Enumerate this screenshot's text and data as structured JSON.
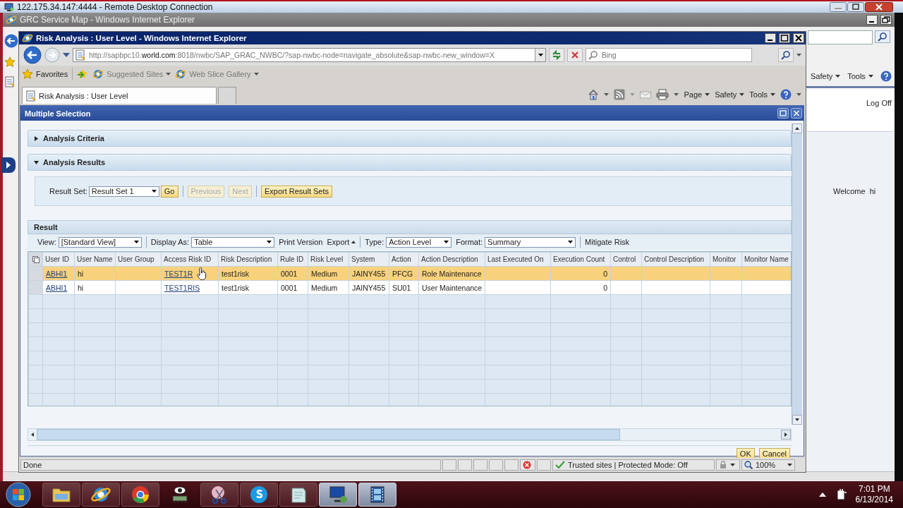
{
  "remote_desktop": {
    "title": "122.175.34.147:4444 - Remote Desktop Connection"
  },
  "background_window": {
    "title": "GRC Service Map - Windows Internet Explorer",
    "commands": [
      "Safety",
      "Tools"
    ],
    "log_off": "Log Off",
    "welcome": "Welcome",
    "user": "hi"
  },
  "window": {
    "title": "Risk Analysis : User Level - Windows Internet Explorer",
    "address": "http://sapbpc10.**world.com**:8018/nwbc/SAP_GRAC_NWBC/?sap-nwbc-node=navigate_absolute&sap-nwbc-new_window=X",
    "search_placeholder": "Bing",
    "favorites": "Favorites",
    "favorite_links": [
      "Suggested Sites",
      "Web Slice Gallery"
    ],
    "tabs": [
      {
        "label": "Risk Analysis : User Level",
        "selected": true
      }
    ],
    "commands": [
      "Page",
      "Safety",
      "Tools"
    ]
  },
  "dialog": {
    "title": "Multiple Selection",
    "sections": [
      {
        "label": "Analysis Criteria",
        "expanded": false
      },
      {
        "label": "Analysis Results",
        "expanded": true
      }
    ],
    "result_set": {
      "label": "Result Set:",
      "value": "Result Set 1"
    },
    "actions": [
      {
        "label": "Go",
        "disabled": false
      },
      {
        "label": "Previous",
        "disabled": true
      },
      {
        "label": "Next",
        "disabled": true
      },
      {
        "label": "Export Result Sets",
        "disabled": false
      }
    ],
    "result": {
      "title": "Result",
      "toolbar": [
        {
          "kind": "select",
          "label": "View:",
          "value": "[Standard View]"
        },
        {
          "kind": "separator"
        },
        {
          "kind": "select",
          "label": "Display As:",
          "value": "Table"
        },
        {
          "kind": "link",
          "label": "Print Version"
        },
        {
          "kind": "menu",
          "label": "Export"
        },
        {
          "kind": "separator"
        },
        {
          "kind": "select",
          "label": "Type:",
          "value": "Action Level"
        },
        {
          "kind": "select",
          "label": "Format:",
          "value": "Summary"
        },
        {
          "kind": "separator"
        },
        {
          "kind": "link",
          "label": "Mitigate Risk"
        }
      ],
      "columns": [
        {
          "label": "User ID",
          "kind": "link"
        },
        {
          "label": "User Name",
          "kind": "text"
        },
        {
          "label": "User Group",
          "kind": "text"
        },
        {
          "label": "Access Risk ID",
          "kind": "link"
        },
        {
          "label": "Risk Description",
          "kind": "text"
        },
        {
          "label": "Rule ID",
          "kind": "text"
        },
        {
          "label": "Risk Level",
          "kind": "text"
        },
        {
          "label": "System",
          "kind": "text"
        },
        {
          "label": "Action",
          "kind": "text"
        },
        {
          "label": "Action Description",
          "kind": "text"
        },
        {
          "label": "Last Executed On",
          "kind": "text"
        },
        {
          "label": "Execution Count",
          "kind": "number"
        },
        {
          "label": "Control",
          "kind": "text"
        },
        {
          "label": "Control Description",
          "kind": "text"
        },
        {
          "label": "Monitor",
          "kind": "text"
        },
        {
          "label": "Monitor Name",
          "kind": "text"
        }
      ],
      "rows": [
        {
          "selected": true,
          "cells": [
            "ABHI1",
            "hi",
            null,
            "TEST1R",
            "test1risk",
            "0001",
            "Medium",
            "JAINY455",
            "PFCG",
            "Role Maintenance",
            null,
            "0",
            null,
            null,
            null,
            null
          ]
        },
        {
          "selected": false,
          "cells": [
            "ABHI1",
            "hi",
            null,
            "TEST1RIS",
            "test1risk",
            "0001",
            "Medium",
            "JAINY455",
            "SU01",
            "User Maintenance",
            null,
            "0",
            null,
            null,
            null,
            null
          ]
        }
      ]
    },
    "buttons": [
      "OK",
      "Cancel"
    ]
  },
  "status_bar": {
    "text": "Done",
    "zone": "Trusted sites | Protected Mode: Off",
    "zoom": "100%"
  },
  "taskbar": {
    "time": "7:01 PM",
    "date": "6/13/2014"
  }
}
